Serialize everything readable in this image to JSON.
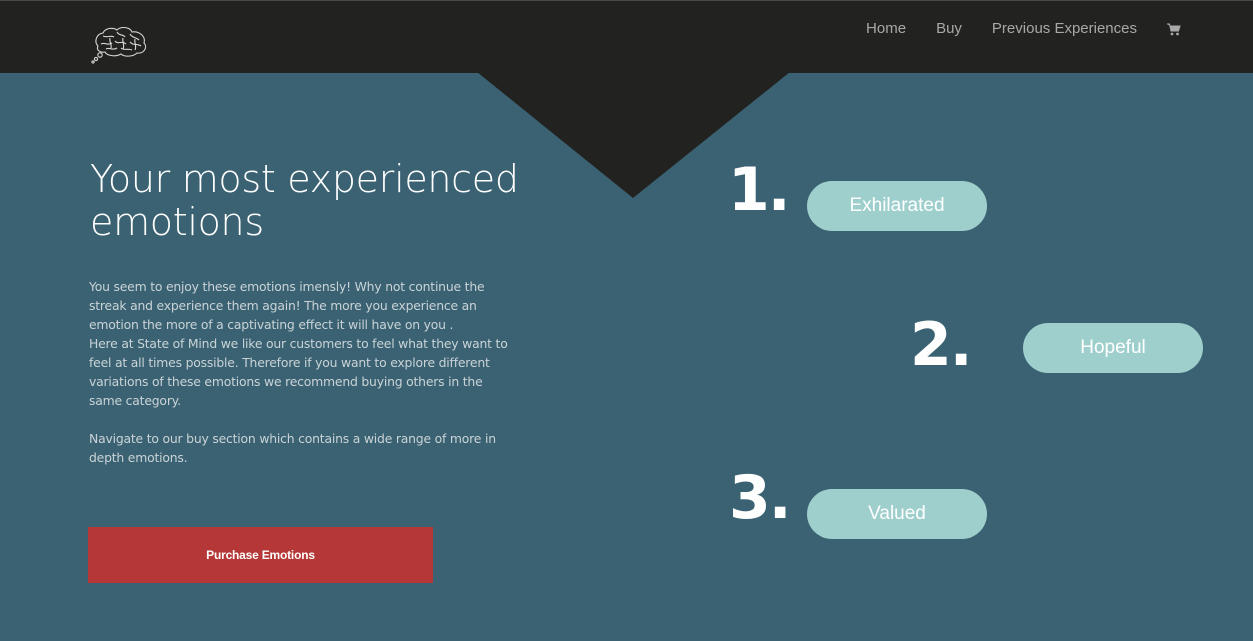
{
  "nav": {
    "home_label": "Home",
    "buy_label": "Buy",
    "previous_label": "Previous Experiences",
    "cart_icon": "shopping-cart-icon"
  },
  "logo": {
    "icon": "brain-logo-icon"
  },
  "main": {
    "headline": "Your most experienced emotions",
    "paragraph1_line1": "You seem to enjoy these emotions imensly! Why not continue the streak and experience them again! The more you experience an emotion the more of a captivating effect it will have on you .",
    "paragraph1_line2": "Here at State of Mind we like our customers to feel what they want to feel at all times possible. Therefore if you want to explore different variations of these emotions we recommend buying others in the same category.",
    "paragraph2": "Navigate to our buy section which contains a wide range of more in depth emotions.",
    "purchase_label": "Purchase Emotions"
  },
  "emotions": [
    {
      "rank": "1.",
      "label": "Exhilarated"
    },
    {
      "rank": "2.",
      "label": "Hopeful"
    },
    {
      "rank": "3.",
      "label": "Valued"
    }
  ],
  "colors": {
    "background": "#3b6272",
    "topbar": "#222220",
    "accent_red": "#b53737",
    "pill": "#9ecfcc"
  }
}
